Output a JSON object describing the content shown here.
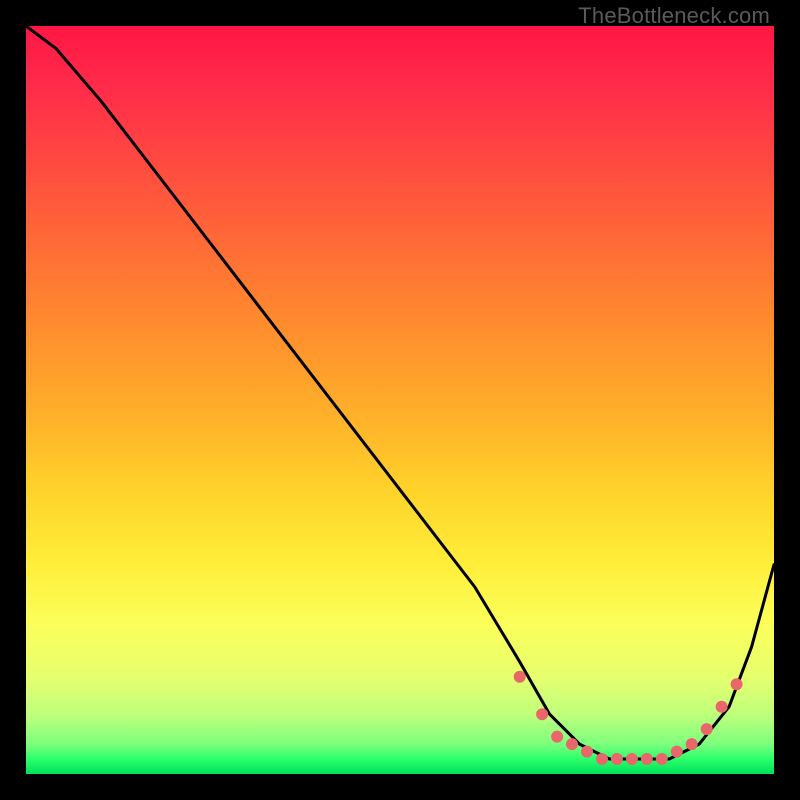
{
  "watermark": "TheBottleneck.com",
  "chart_data": {
    "type": "line",
    "title": "",
    "xlabel": "",
    "ylabel": "",
    "xlim": [
      0,
      100
    ],
    "ylim": [
      0,
      100
    ],
    "grid": false,
    "legend": false,
    "background": "vertical-heat-gradient",
    "series": [
      {
        "name": "bottleneck-curve",
        "color": "#000000",
        "x": [
          0,
          4,
          10,
          20,
          30,
          40,
          50,
          60,
          66,
          70,
          74,
          78,
          82,
          86,
          90,
          94,
          97,
          100
        ],
        "values": [
          100,
          97,
          90,
          77,
          64,
          51,
          38,
          25,
          15,
          8,
          4,
          2,
          2,
          2,
          4,
          9,
          17,
          28
        ]
      }
    ],
    "markers": {
      "name": "bottleneck-floor-markers",
      "color": "#e9676b",
      "x": [
        66,
        69,
        71,
        73,
        75,
        77,
        79,
        81,
        83,
        85,
        87,
        89,
        91,
        93,
        95
      ],
      "values": [
        13,
        8,
        5,
        4,
        3,
        2,
        2,
        2,
        2,
        2,
        3,
        4,
        6,
        9,
        12
      ]
    }
  }
}
